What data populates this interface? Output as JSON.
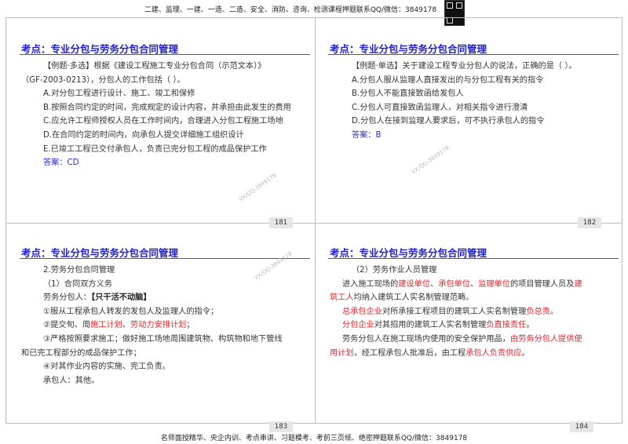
{
  "banner_top": "二建、监理、一建、一造、二造、安全、消防、咨询、检测课程押题联系QQ/微信：3849178",
  "banner_bottom": "名师面授精华、央企内训、考点串讲、习题模考、考前三页纸、绝密押题联系QQ/微信：3849178",
  "watermark": "VX/QQ:3849178",
  "slides": [
    {
      "title": "考点：专业分包与劳务分包合同管理",
      "page": "181",
      "lines": [
        {
          "cls": "ind2",
          "segs": [
            {
              "t": "【例题·多选】根据《建设工程施工专业分包合同（示范文本）》"
            }
          ]
        },
        {
          "cls": "",
          "segs": [
            {
              "t": "（GF-2003-0213），分包人的工作包括（ ）。"
            }
          ]
        },
        {
          "cls": "ind2",
          "segs": [
            {
              "t": "A.对分包工程进行设计、施工、竣工和保修"
            }
          ]
        },
        {
          "cls": "ind2",
          "segs": [
            {
              "t": "B.按照合同约定的时间，完成规定的设计内容，并承担由此发生的费用"
            }
          ]
        },
        {
          "cls": "ind2",
          "segs": [
            {
              "t": "C.应允许工程师授权人员在工作时间内，合理进入分包工程施工场地"
            }
          ]
        },
        {
          "cls": "ind2",
          "segs": [
            {
              "t": "D.在合同约定的时间内，向承包人提交详细施工组织设计"
            }
          ]
        },
        {
          "cls": "ind2",
          "segs": [
            {
              "t": "E.已竣工工程已交付承包人，负责已完分包工程的成品保护工作"
            }
          ]
        },
        {
          "cls": "ind2 answer",
          "segs": [
            {
              "t": "答案：CD"
            }
          ]
        }
      ]
    },
    {
      "title": "考点：专业分包与劳务分包合同管理",
      "page": "182",
      "lines": [
        {
          "cls": "ind2",
          "segs": [
            {
              "t": "【例题·单选】关于建设工程专业分包人的说法，正确的是（ ）。"
            }
          ]
        },
        {
          "cls": "ind2",
          "segs": [
            {
              "t": "A.分包人服从监理人直接发出的与分包工程有关的指令"
            }
          ]
        },
        {
          "cls": "ind2",
          "segs": [
            {
              "t": "B.分包人不能直接致函给发包人"
            }
          ]
        },
        {
          "cls": "ind2",
          "segs": [
            {
              "t": "C.分包人可直接致函监理人，对相关指令进行澄清"
            }
          ]
        },
        {
          "cls": "ind2",
          "segs": [
            {
              "t": "D.分包人在接到监理人要求后，可不执行承包人的指令"
            }
          ]
        },
        {
          "cls": "ind2 answer",
          "segs": [
            {
              "t": "答案：B"
            }
          ]
        }
      ]
    },
    {
      "title": "考点：专业分包与劳务分包合同管理",
      "page": "183",
      "lines": [
        {
          "cls": "ind2",
          "segs": [
            {
              "t": "2.劳务分包合同管理"
            }
          ]
        },
        {
          "cls": "ind2",
          "segs": [
            {
              "t": "（1）合同双方义务"
            }
          ]
        },
        {
          "cls": "ind2",
          "segs": [
            {
              "t": "劳务分包人："
            },
            {
              "t": "【只干活不动脑】",
              "s": "bold"
            }
          ]
        },
        {
          "cls": "ind2",
          "segs": [
            {
              "t": "①服从工程承包人转发的发包人及监理人的指令；"
            }
          ]
        },
        {
          "cls": "ind2",
          "segs": [
            {
              "t": "②提交旬、周"
            },
            {
              "t": "施工计划",
              "s": "red"
            },
            {
              "t": "、"
            },
            {
              "t": "劳动力安排计划",
              "s": "red"
            },
            {
              "t": "；"
            }
          ]
        },
        {
          "cls": "ind2",
          "segs": [
            {
              "t": "③严格按照要求施工；做好施工场地周围建筑物、构筑物和地下管线"
            }
          ]
        },
        {
          "cls": "",
          "segs": [
            {
              "t": "和已完工程部分的成品保护工作；"
            }
          ]
        },
        {
          "cls": "ind2",
          "segs": [
            {
              "t": "④对其作业内容的实施、完工负责。"
            }
          ]
        },
        {
          "cls": "ind2",
          "segs": [
            {
              "t": "承包人：其他。"
            }
          ]
        }
      ]
    },
    {
      "title": "考点：专业分包与劳务分包合同管理",
      "page": "184",
      "lines": [
        {
          "cls": "ind2",
          "segs": [
            {
              "t": "（2）劳务作业人员管理"
            }
          ]
        },
        {
          "cls": "ind1",
          "segs": [
            {
              "t": "进入施工现场的"
            },
            {
              "t": "建设单位",
              "s": "red"
            },
            {
              "t": "、"
            },
            {
              "t": "承包单位",
              "s": "red"
            },
            {
              "t": "、"
            },
            {
              "t": "监理单位",
              "s": "red"
            },
            {
              "t": "的项目管理人员及"
            },
            {
              "t": "建",
              "s": "red"
            }
          ]
        },
        {
          "cls": "",
          "segs": [
            {
              "t": "筑工人",
              "s": "red"
            },
            {
              "t": "均纳入建筑工人实名制管理范畴。"
            }
          ]
        },
        {
          "cls": "ind1",
          "segs": [
            {
              "t": "总承包企业",
              "s": "red"
            },
            {
              "t": "对所承接工程项目的建筑工人实名制管理"
            },
            {
              "t": "负总责",
              "s": "red"
            },
            {
              "t": "。"
            }
          ]
        },
        {
          "cls": "ind1",
          "segs": [
            {
              "t": "分包企业",
              "s": "red"
            },
            {
              "t": "对其招用的建筑工人实名制管理"
            },
            {
              "t": "负直接责任",
              "s": "red"
            },
            {
              "t": "。"
            }
          ]
        },
        {
          "cls": "ind1",
          "segs": [
            {
              "t": "劳务分包人在施工现场内使用的安全保护用品，"
            },
            {
              "t": "由劳务分包人提供使",
              "s": "red"
            }
          ]
        },
        {
          "cls": "",
          "segs": [
            {
              "t": "用计划",
              "s": "red"
            },
            {
              "t": "，经工程承包人批准后，由工程"
            },
            {
              "t": "承包人负责供应",
              "s": "red"
            },
            {
              "t": "。"
            }
          ]
        }
      ]
    }
  ]
}
